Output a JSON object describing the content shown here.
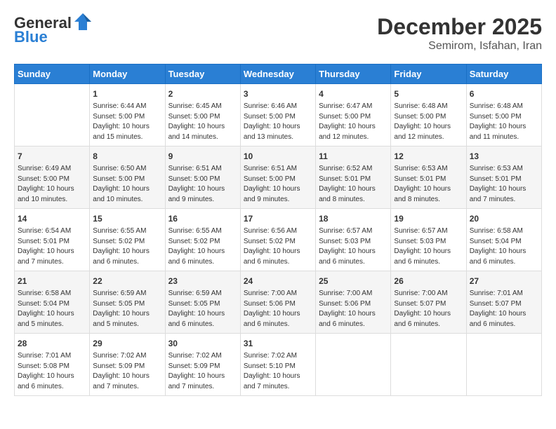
{
  "header": {
    "logo": {
      "general": "General",
      "blue": "Blue"
    },
    "title": "December 2025",
    "location": "Semirom, Isfahan, Iran"
  },
  "calendar": {
    "days_of_week": [
      "Sunday",
      "Monday",
      "Tuesday",
      "Wednesday",
      "Thursday",
      "Friday",
      "Saturday"
    ],
    "weeks": [
      [
        {
          "day": "",
          "content": ""
        },
        {
          "day": "1",
          "content": "Sunrise: 6:44 AM\nSunset: 5:00 PM\nDaylight: 10 hours\nand 15 minutes."
        },
        {
          "day": "2",
          "content": "Sunrise: 6:45 AM\nSunset: 5:00 PM\nDaylight: 10 hours\nand 14 minutes."
        },
        {
          "day": "3",
          "content": "Sunrise: 6:46 AM\nSunset: 5:00 PM\nDaylight: 10 hours\nand 13 minutes."
        },
        {
          "day": "4",
          "content": "Sunrise: 6:47 AM\nSunset: 5:00 PM\nDaylight: 10 hours\nand 12 minutes."
        },
        {
          "day": "5",
          "content": "Sunrise: 6:48 AM\nSunset: 5:00 PM\nDaylight: 10 hours\nand 12 minutes."
        },
        {
          "day": "6",
          "content": "Sunrise: 6:48 AM\nSunset: 5:00 PM\nDaylight: 10 hours\nand 11 minutes."
        }
      ],
      [
        {
          "day": "7",
          "content": "Sunrise: 6:49 AM\nSunset: 5:00 PM\nDaylight: 10 hours\nand 10 minutes."
        },
        {
          "day": "8",
          "content": "Sunrise: 6:50 AM\nSunset: 5:00 PM\nDaylight: 10 hours\nand 10 minutes."
        },
        {
          "day": "9",
          "content": "Sunrise: 6:51 AM\nSunset: 5:00 PM\nDaylight: 10 hours\nand 9 minutes."
        },
        {
          "day": "10",
          "content": "Sunrise: 6:51 AM\nSunset: 5:00 PM\nDaylight: 10 hours\nand 9 minutes."
        },
        {
          "day": "11",
          "content": "Sunrise: 6:52 AM\nSunset: 5:01 PM\nDaylight: 10 hours\nand 8 minutes."
        },
        {
          "day": "12",
          "content": "Sunrise: 6:53 AM\nSunset: 5:01 PM\nDaylight: 10 hours\nand 8 minutes."
        },
        {
          "day": "13",
          "content": "Sunrise: 6:53 AM\nSunset: 5:01 PM\nDaylight: 10 hours\nand 7 minutes."
        }
      ],
      [
        {
          "day": "14",
          "content": "Sunrise: 6:54 AM\nSunset: 5:01 PM\nDaylight: 10 hours\nand 7 minutes."
        },
        {
          "day": "15",
          "content": "Sunrise: 6:55 AM\nSunset: 5:02 PM\nDaylight: 10 hours\nand 6 minutes."
        },
        {
          "day": "16",
          "content": "Sunrise: 6:55 AM\nSunset: 5:02 PM\nDaylight: 10 hours\nand 6 minutes."
        },
        {
          "day": "17",
          "content": "Sunrise: 6:56 AM\nSunset: 5:02 PM\nDaylight: 10 hours\nand 6 minutes."
        },
        {
          "day": "18",
          "content": "Sunrise: 6:57 AM\nSunset: 5:03 PM\nDaylight: 10 hours\nand 6 minutes."
        },
        {
          "day": "19",
          "content": "Sunrise: 6:57 AM\nSunset: 5:03 PM\nDaylight: 10 hours\nand 6 minutes."
        },
        {
          "day": "20",
          "content": "Sunrise: 6:58 AM\nSunset: 5:04 PM\nDaylight: 10 hours\nand 6 minutes."
        }
      ],
      [
        {
          "day": "21",
          "content": "Sunrise: 6:58 AM\nSunset: 5:04 PM\nDaylight: 10 hours\nand 5 minutes."
        },
        {
          "day": "22",
          "content": "Sunrise: 6:59 AM\nSunset: 5:05 PM\nDaylight: 10 hours\nand 5 minutes."
        },
        {
          "day": "23",
          "content": "Sunrise: 6:59 AM\nSunset: 5:05 PM\nDaylight: 10 hours\nand 6 minutes."
        },
        {
          "day": "24",
          "content": "Sunrise: 7:00 AM\nSunset: 5:06 PM\nDaylight: 10 hours\nand 6 minutes."
        },
        {
          "day": "25",
          "content": "Sunrise: 7:00 AM\nSunset: 5:06 PM\nDaylight: 10 hours\nand 6 minutes."
        },
        {
          "day": "26",
          "content": "Sunrise: 7:00 AM\nSunset: 5:07 PM\nDaylight: 10 hours\nand 6 minutes."
        },
        {
          "day": "27",
          "content": "Sunrise: 7:01 AM\nSunset: 5:07 PM\nDaylight: 10 hours\nand 6 minutes."
        }
      ],
      [
        {
          "day": "28",
          "content": "Sunrise: 7:01 AM\nSunset: 5:08 PM\nDaylight: 10 hours\nand 6 minutes."
        },
        {
          "day": "29",
          "content": "Sunrise: 7:02 AM\nSunset: 5:09 PM\nDaylight: 10 hours\nand 7 minutes."
        },
        {
          "day": "30",
          "content": "Sunrise: 7:02 AM\nSunset: 5:09 PM\nDaylight: 10 hours\nand 7 minutes."
        },
        {
          "day": "31",
          "content": "Sunrise: 7:02 AM\nSunset: 5:10 PM\nDaylight: 10 hours\nand 7 minutes."
        },
        {
          "day": "",
          "content": ""
        },
        {
          "day": "",
          "content": ""
        },
        {
          "day": "",
          "content": ""
        }
      ]
    ]
  }
}
